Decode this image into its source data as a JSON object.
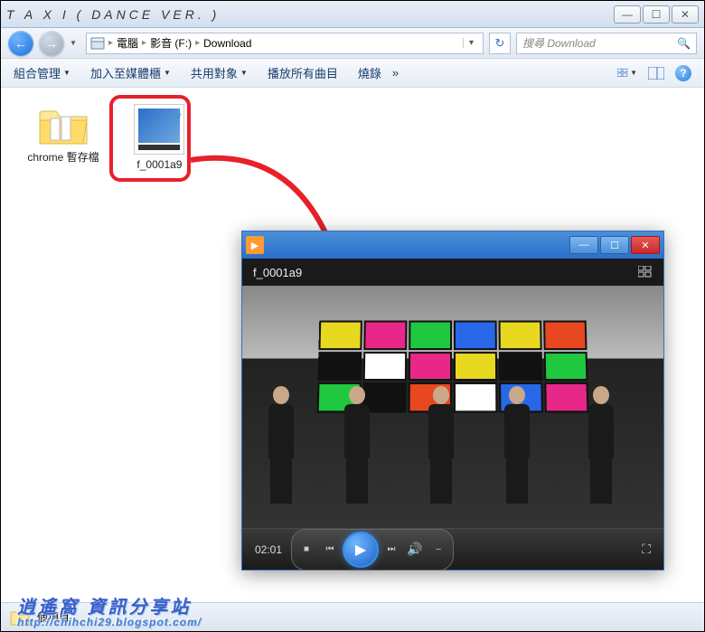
{
  "window": {
    "title": "T A X I   ( DANCE VER. )",
    "min_tip": "—",
    "max_tip": "☐",
    "close_tip": "✕"
  },
  "breadcrumb": {
    "items": [
      "電腦",
      "影音 (F:)",
      "Download"
    ],
    "refresh": "↻"
  },
  "search": {
    "placeholder": "搜尋 Download"
  },
  "toolbar": {
    "organize": "組合管理",
    "include": "加入至媒體櫃",
    "share": "共用對象",
    "playall": "播放所有曲目",
    "burn": "燒錄",
    "overflow": "»"
  },
  "files": [
    {
      "name": "chrome 暫存檔",
      "type": "folder"
    },
    {
      "name": "f_0001a9",
      "type": "video"
    }
  ],
  "player": {
    "filename": "f_0001a9",
    "time": "02:01"
  },
  "statusbar": {
    "text": "個項目"
  },
  "watermark": {
    "line1": "逍遙窩 資訊分享站",
    "line2": "http://chihchi29.blogspot.com/"
  }
}
